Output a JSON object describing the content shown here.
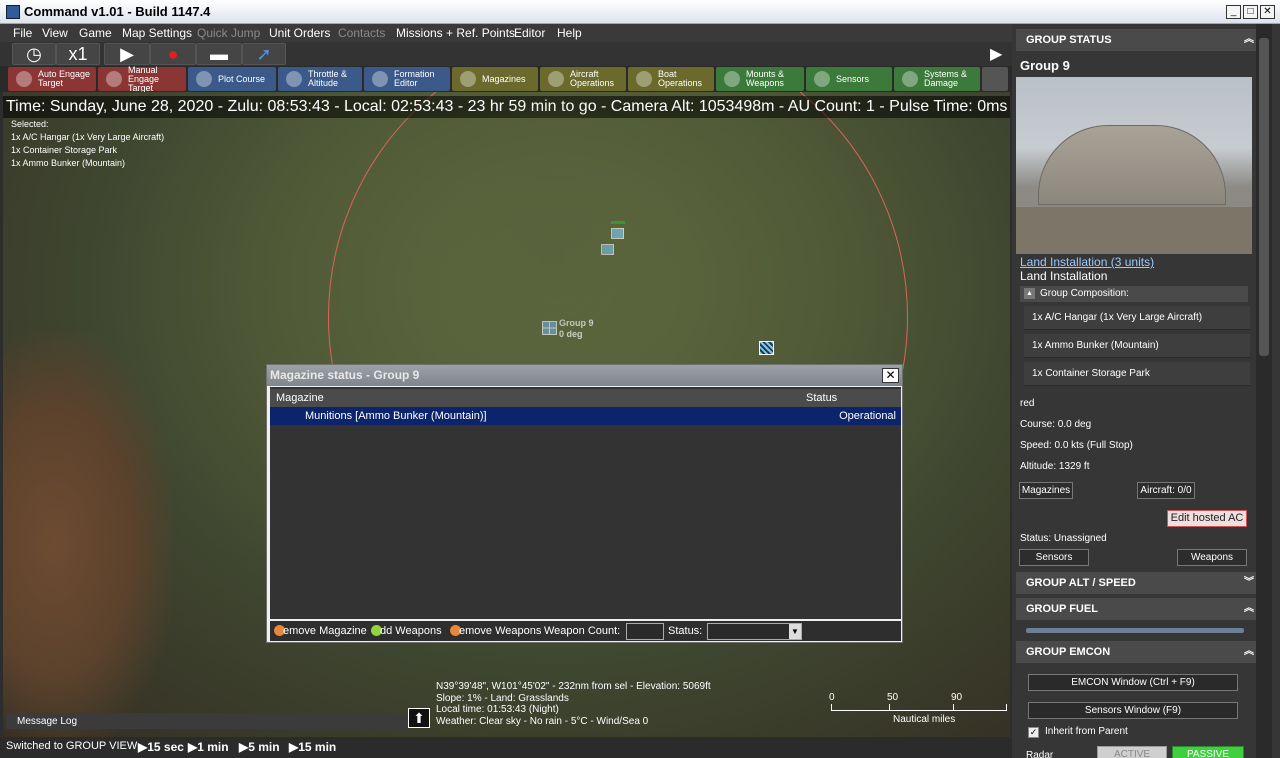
{
  "window": {
    "title": "Command v1.01 - Build 1147.4",
    "controls": [
      "_",
      "□",
      "✕"
    ]
  },
  "menu": [
    "File",
    "View",
    "Game",
    "Map Settings",
    "Quick Jump",
    "Unit Orders",
    "Contacts",
    "Missions + Ref. Points",
    "Editor",
    "Help"
  ],
  "playbar": {
    "speed": "x1"
  },
  "toolbar": [
    "Auto Engage\nTarget",
    "Manual\nEngage Target",
    "Plot Course",
    "Throttle &\nAltitude",
    "Formation\nEditor",
    "Magazines",
    "Aircraft\nOperations",
    "Boat\nOperations",
    "Mounts &\nWeapons",
    "Sensors",
    "Systems &\nDamage"
  ],
  "map": {
    "timebar": "Time: Sunday, June 28, 2020 - Zulu: 08:53:43 - Local: 02:53:43 - 23 hr 59 min to go - Camera Alt: 1053498m - AU Count: 1 - Pulse Time: 0ms",
    "selected": [
      "Selected:",
      "1x A/C Hangar (1x Very Large Aircraft)",
      "1x Container Storage Park",
      "1x Ammo Bunker (Mountain)"
    ],
    "group_label": [
      "Group 9",
      "0 deg"
    ],
    "coords": [
      "N39°39'48\", W101°45'02\" - 232nm from sel - Elevation: 5069ft",
      "Slope: 1% - Land: Grasslands",
      "Local time: 01:53:43 (Night)",
      "Weather: Clear sky - No rain - 5°C - Wind/Sea 0"
    ],
    "scale": {
      "ticks": [
        "0",
        "50",
        "90"
      ],
      "unit": "Nautical miles"
    },
    "message_log": "Message Log"
  },
  "statusbar": {
    "message": "Switched to GROUP VIEW",
    "steps": [
      "15 sec",
      "1 min",
      "5 min",
      "15 min"
    ]
  },
  "magazine_dialog": {
    "title": "Magazine status - Group 9",
    "columns": [
      "Magazine",
      "Status"
    ],
    "rows": [
      {
        "magazine": "Munitions [Ammo Bunker (Mountain)]",
        "status": "Operational"
      }
    ],
    "footer": {
      "remove_magazine": "emove Magazine",
      "add_weapons": "dd Weapons",
      "remove_weapons": "emove Weapons",
      "weapon_count_label": "Weapon Count:",
      "status_label": "Status:"
    }
  },
  "right_panel": {
    "group_status_header": "GROUP STATUS",
    "group_name": "Group 9",
    "unit_link": "Land Installation (3 units)",
    "unit_type": "Land Installation",
    "composition_header": "Group Composition:",
    "composition": [
      "1x A/C Hangar (1x Very Large Aircraft)",
      "1x Ammo Bunker (Mountain)",
      "1x Container Storage Park"
    ],
    "side": "red",
    "course": "Course: 0.0 deg",
    "speed": "Speed: 0.0 kts (Full Stop)",
    "altitude": "Altitude: 1329 ft",
    "magazines_btn": "Magazines",
    "aircraft_btn": "Aircraft: 0/0",
    "edit_hosted_btn": "Edit hosted AC",
    "status": "Status: Unassigned",
    "sensors_btn": "Sensors",
    "weapons_btn": "Weapons",
    "alt_speed_header": "GROUP ALT / SPEED",
    "fuel_header": "GROUP FUEL",
    "emcon_header": "GROUP EMCON",
    "emcon_window_btn": "EMCON Window (Ctrl + F9)",
    "sensors_window_btn": "Sensors Window (F9)",
    "inherit_label": "Inherit from Parent",
    "radar_label": "Radar",
    "active_btn": "ACTIVE",
    "passive_btn": "PASSIVE"
  },
  "colors": {
    "accent_red": "#a33b3b",
    "accent_blue": "#3b5a8a",
    "accent_olive": "#6b6a2c",
    "accent_green": "#3b7a3b",
    "passive_green": "#3fcf3f"
  }
}
